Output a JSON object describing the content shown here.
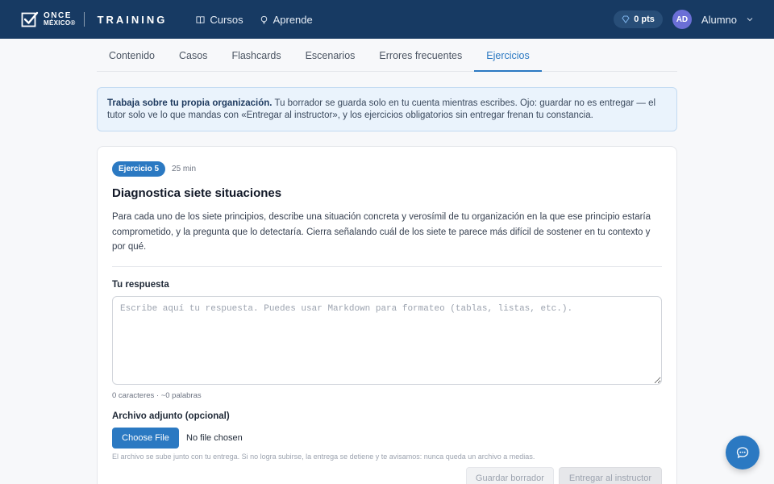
{
  "header": {
    "brand_top": "ONCE",
    "brand_bottom": "MÉXICO®",
    "brand_product": "TRAINING",
    "nav": [
      {
        "label": "Cursos",
        "icon": "book-icon"
      },
      {
        "label": "Aprende",
        "icon": "lightbulb-icon"
      }
    ],
    "points": "0 pts",
    "avatar_initials": "AD",
    "user_name": "Alumno"
  },
  "tabs": [
    {
      "label": "Contenido",
      "active": false
    },
    {
      "label": "Casos",
      "active": false
    },
    {
      "label": "Flashcards",
      "active": false
    },
    {
      "label": "Escenarios",
      "active": false
    },
    {
      "label": "Errores frecuentes",
      "active": false
    },
    {
      "label": "Ejercicios",
      "active": true
    }
  ],
  "banner": {
    "bold": "Trabaja sobre tu propia organización.",
    "text": " Tu borrador se guarda solo en tu cuenta mientras escribes. Ojo: guardar no es entregar — el tutor solo ve lo que mandas con «Entregar al instructor», y los ejercicios obligatorios sin entregar frenan tu constancia."
  },
  "exercise": {
    "badge": "Ejercicio 5",
    "duration": "25 min",
    "title": "Diagnostica siete situaciones",
    "description": "Para cada uno de los siete principios, describe una situación concreta y verosímil de tu organización en la que ese principio estaría comprometido, y la pregunta que lo detectaría. Cierra señalando cuál de los siete te parece más difícil de sostener en tu contexto y por qué.",
    "response_label": "Tu respuesta",
    "response_placeholder": "Escribe aquí tu respuesta. Puedes usar Markdown para formateo (tablas, listas, etc.).",
    "response_value": "",
    "counter": "0 caracteres · ~0 palabras",
    "attach_label": "Archivo adjunto (opcional)",
    "choose_file": "Choose File",
    "file_status": "No file chosen",
    "attach_hint": "El archivo se sube junto con tu entrega. Si no logra subirse, la entrega se detiene y te avisamos: nunca queda un archivo a medias.",
    "save_draft": "Guardar borrador",
    "submit": "Entregar al instructor"
  },
  "colors": {
    "topbar": "#173a63",
    "accent": "#2b79c2",
    "avatar": "#6b6fd6"
  }
}
